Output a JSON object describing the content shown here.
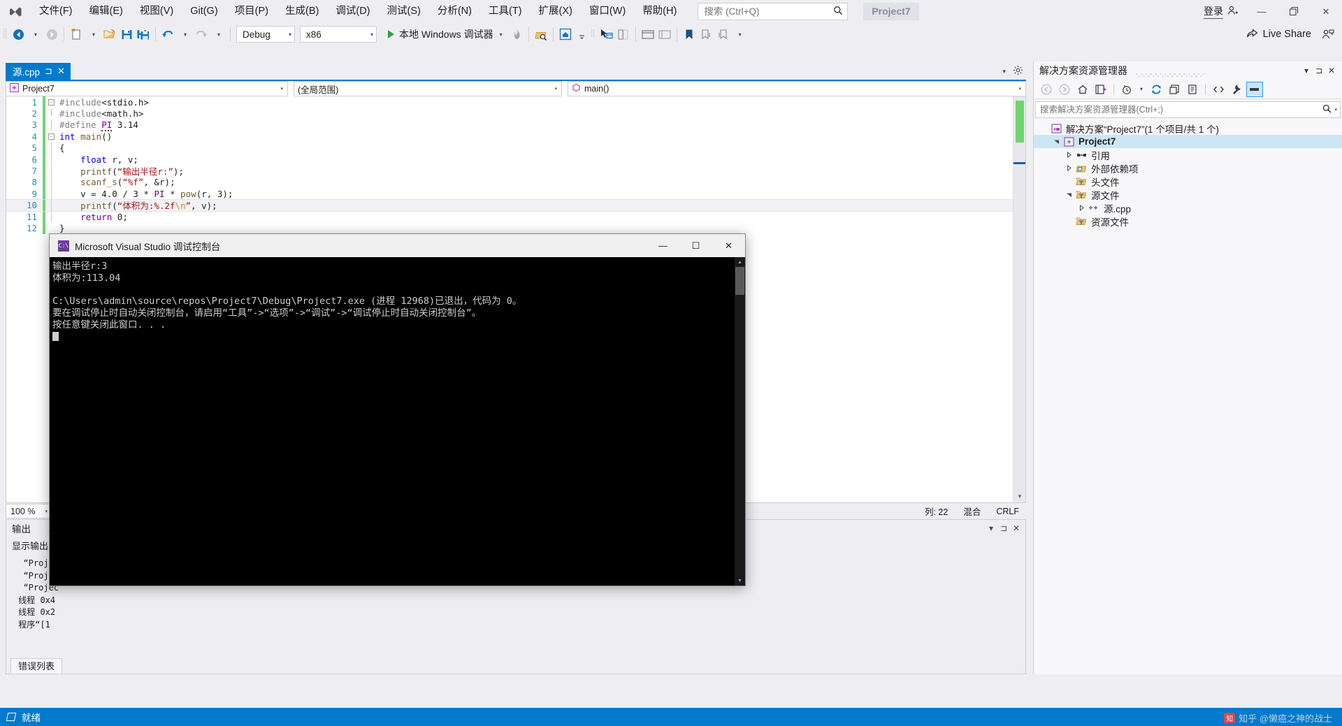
{
  "titlebar": {
    "logo": "visual-studio-logo",
    "menus": [
      "文件(F)",
      "编辑(E)",
      "视图(V)",
      "Git(G)",
      "项目(P)",
      "生成(B)",
      "调试(D)",
      "测试(S)",
      "分析(N)",
      "工具(T)",
      "扩展(X)",
      "窗口(W)",
      "帮助(H)"
    ],
    "search_placeholder": "搜索 (Ctrl+Q)",
    "project_chip": "Project7",
    "signin": "登录",
    "minimize": "—",
    "maximize": "❐",
    "close": "✕"
  },
  "toolbar": {
    "config": "Debug",
    "platform": "x86",
    "run_label": "本地 Windows 调试器",
    "live_share": "Live Share"
  },
  "editor_tab": {
    "title": "源.cpp",
    "pin": "⊐",
    "close": "✕"
  },
  "navbar": {
    "project": "Project7",
    "scope": "(全局范围)",
    "member": "main()"
  },
  "code": {
    "lines": [
      {
        "n": "1",
        "fold": "-",
        "html": "<span class=\"pp\">#include</span><span class=\"pl\">&lt;</span><span class=\"pl\">stdio.h</span><span class=\"pl\">&gt;</span>"
      },
      {
        "n": "2",
        "fold": "",
        "html": "<span class=\"pp\">#include</span><span class=\"pl\">&lt;</span><span class=\"pl\">math.h</span><span class=\"pl\">&gt;</span>"
      },
      {
        "n": "3",
        "fold": "",
        "html": "<span class=\"pp\">#define</span> <span class=\"mac ident-squig\">PI</span> <span class=\"num\">3.14</span>"
      },
      {
        "n": "4",
        "fold": "-",
        "html": "<span class=\"kw\">int</span> <span class=\"fn\">main</span><span class=\"pl\">()</span>"
      },
      {
        "n": "5",
        "fold": "",
        "html": "<span class=\"pl\">{</span>"
      },
      {
        "n": "6",
        "fold": "",
        "html": "    <span class=\"kw\">float</span> <span class=\"pl\">r, v;</span>"
      },
      {
        "n": "7",
        "fold": "",
        "html": "    <span class=\"fn\">printf</span><span class=\"pl\">(</span><span class=\"str\">“输出半径r:”</span><span class=\"pl\">);</span>"
      },
      {
        "n": "8",
        "fold": "",
        "html": "    <span class=\"fn\">scanf_s</span><span class=\"pl\">(</span><span class=\"str\">“%f”</span><span class=\"pl\">, &amp;r);</span>"
      },
      {
        "n": "9",
        "fold": "",
        "html": "    <span class=\"pl\">v = </span><span class=\"num\">4.0</span><span class=\"pl\"> / </span><span class=\"num\">3</span><span class=\"pl\"> * </span><span class=\"mac\">PI</span><span class=\"pl\"> * </span><span class=\"fn\">pow</span><span class=\"pl\">(r, </span><span class=\"num\">3</span><span class=\"pl\">);</span>"
      },
      {
        "n": "10",
        "fold": "",
        "html": "    <span class=\"fn\">printf</span><span class=\"pl\">(</span><span class=\"str\">“体积为:%.2f</span><span class=\"esc\">\\n</span><span class=\"str\">”</span><span class=\"pl\">, v);</span>"
      },
      {
        "n": "11",
        "fold": "",
        "html": "    <span class=\"kw\" style=\"color:#6f008a\">return</span> <span class=\"num\">0</span><span class=\"pl\">;</span>"
      },
      {
        "n": "12",
        "fold": "",
        "html": "<span class=\"pl\">}</span>"
      }
    ],
    "current_line_index": 9
  },
  "zoom_row": {
    "zoom": "100 %",
    "col": "列: 22",
    "mode": "混合",
    "eol": "CRLF"
  },
  "output_panel": {
    "title": "输出",
    "source_label": "显示输出来源(S):",
    "lines": [
      "  “Projec",
      "  “Projec",
      "  “Projec",
      " 线程 0x4",
      " 线程 0x2",
      " 程序“[1"
    ],
    "tab": "错误列表"
  },
  "solution_explorer": {
    "title": "解决方案资源管理器",
    "search_placeholder": "搜索解决方案资源管理器(Ctrl+;)",
    "tree": [
      {
        "indent": 0,
        "twisty": "",
        "icon": "solution-icon",
        "label": "解决方案“Project7”(1 个项目/共 1 个)",
        "selected": false
      },
      {
        "indent": 1,
        "twisty": "▲",
        "icon": "project-icon",
        "label": "Project7",
        "selected": true
      },
      {
        "indent": 2,
        "twisty": "▶",
        "icon": "references-icon",
        "label": "引用",
        "selected": false
      },
      {
        "indent": 2,
        "twisty": "▶",
        "icon": "extdeps-icon",
        "label": "外部依赖项",
        "selected": false
      },
      {
        "indent": 2,
        "twisty": "",
        "icon": "filter-icon",
        "label": "头文件",
        "selected": false
      },
      {
        "indent": 2,
        "twisty": "▲",
        "icon": "filter-icon",
        "label": "源文件",
        "selected": false
      },
      {
        "indent": 3,
        "twisty": "▶",
        "icon": "cpp-file-icon",
        "label": "源.cpp",
        "selected": false
      },
      {
        "indent": 2,
        "twisty": "",
        "icon": "filter-icon",
        "label": "资源文件",
        "selected": false
      }
    ]
  },
  "console": {
    "title": "Microsoft Visual Studio 调试控制台",
    "minimize": "—",
    "maximize": "☐",
    "close": "✕",
    "lines": [
      "输出半径r:3",
      "体积为:113.04",
      "",
      "C:\\Users\\admin\\source\\repos\\Project7\\Debug\\Project7.exe (进程 12968)已退出，代码为 0。",
      "要在调试停止时自动关闭控制台，请启用“工具”->“选项”->“调试”->“调试停止时自动关闭控制台”。",
      "按任意键关闭此窗口. . ."
    ]
  },
  "statusbar": {
    "ready": "就绪"
  },
  "watermark": {
    "text": "知乎 @懒癌之神的战士",
    "badge": "知"
  }
}
